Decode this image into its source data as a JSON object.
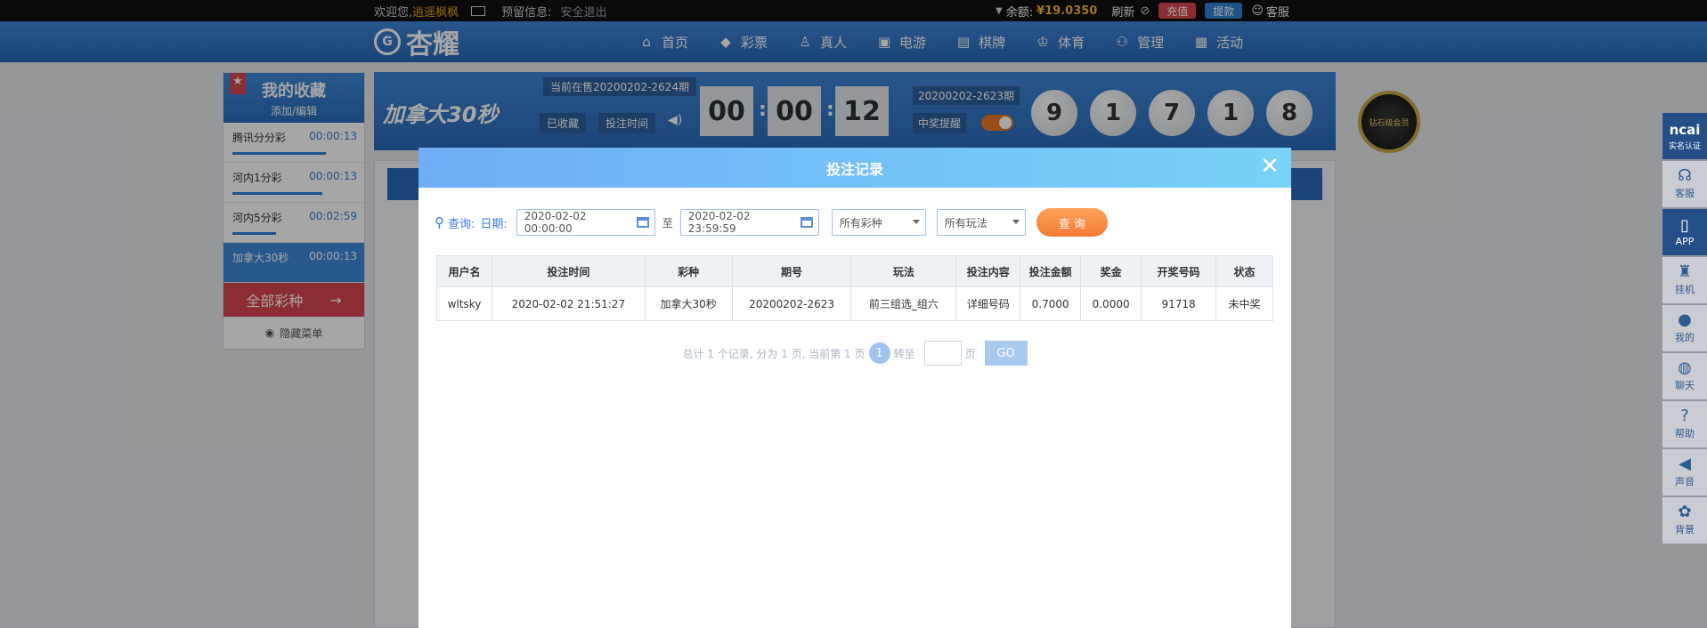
{
  "topbar": {
    "welcome": "欢迎您,",
    "username": "逍遥枫枫",
    "notice_label": "预留信息:",
    "logout": "安全退出",
    "balance_label": "余额:",
    "balance_value": "¥19.0350",
    "refresh": "刷新",
    "recharge": "充值",
    "withdraw": "提款",
    "service": "客服"
  },
  "nav": {
    "logo": "杏耀",
    "items": [
      {
        "label": "首页",
        "icon": "home-icon"
      },
      {
        "label": "彩票",
        "icon": "lottery-icon"
      },
      {
        "label": "真人",
        "icon": "live-icon"
      },
      {
        "label": "电游",
        "icon": "slot-icon"
      },
      {
        "label": "棋牌",
        "icon": "cards-icon"
      },
      {
        "label": "体育",
        "icon": "trophy-icon"
      },
      {
        "label": "管理",
        "icon": "manage-icon"
      },
      {
        "label": "活动",
        "icon": "gift-icon"
      }
    ]
  },
  "favorites": {
    "title": "我的收藏",
    "edit": "添加/编辑",
    "items": [
      {
        "name": "腾讯分分彩",
        "time": "00:00:13",
        "progress": 0.75
      },
      {
        "name": "河内1分彩",
        "time": "00:00:13",
        "progress": 0.72
      },
      {
        "name": "河内5分彩",
        "time": "00:02:59",
        "progress": 0.35
      },
      {
        "name": "加拿大30秒",
        "time": "00:00:13",
        "progress": 0.5
      }
    ],
    "all": "全部彩种",
    "hide": "隐藏菜单"
  },
  "game": {
    "name": "加拿大30秒",
    "current": "当前在售20200202-2624期",
    "collected": "已收藏",
    "bet_time": "投注时间",
    "timer": [
      "00",
      "00",
      "12"
    ],
    "prev_issue": "20200202-2623期",
    "remind": "中奖提醒",
    "balls": [
      "9",
      "1",
      "7",
      "1",
      "8"
    ],
    "vip_badge": "钻石级会员"
  },
  "rail": [
    {
      "label": "实名认证",
      "icon": "ncai-icon",
      "head": "ncai"
    },
    {
      "label": "客服",
      "icon": "headset-icon"
    },
    {
      "label": "APP",
      "icon": "phone-icon"
    },
    {
      "label": "挂机",
      "icon": "robot-icon"
    },
    {
      "label": "我的",
      "icon": "user-icon"
    },
    {
      "label": "聊天",
      "icon": "chat-icon"
    },
    {
      "label": "帮助",
      "icon": "help-icon"
    },
    {
      "label": "声音",
      "icon": "sound-icon"
    },
    {
      "label": "背景",
      "icon": "palette-icon"
    }
  ],
  "modal": {
    "title": "投注记录",
    "query_label": "查询:",
    "date_label": "日期:",
    "start_date": "2020-02-02 00:00:00",
    "to": "至",
    "end_date": "2020-02-02 23:59:59",
    "lottery_select": "所有彩种",
    "play_select": "所有玩法",
    "query_button": "查 询",
    "columns": [
      "用户名",
      "投注时间",
      "彩种",
      "期号",
      "玩法",
      "投注内容",
      "投注金额",
      "奖金",
      "开奖号码",
      "状态"
    ],
    "rows": [
      [
        "wltsky",
        "2020-02-02 21:51:27",
        "加拿大30秒",
        "20200202-2623",
        "前三组选_组六",
        "详细号码",
        "0.7000",
        "0.0000",
        "91718",
        "未中奖"
      ]
    ],
    "pager": {
      "summary": "总计 1 个记录, 分为 1 页, 当前第 1 页",
      "page": "1",
      "goto": "转至",
      "unit": "页",
      "go": "GO"
    }
  },
  "colors": {
    "nav_blue": "#2f76c8",
    "accent_red": "#d8444f",
    "accent_orange": "#f27b35",
    "modal_header": "#6faef6"
  }
}
